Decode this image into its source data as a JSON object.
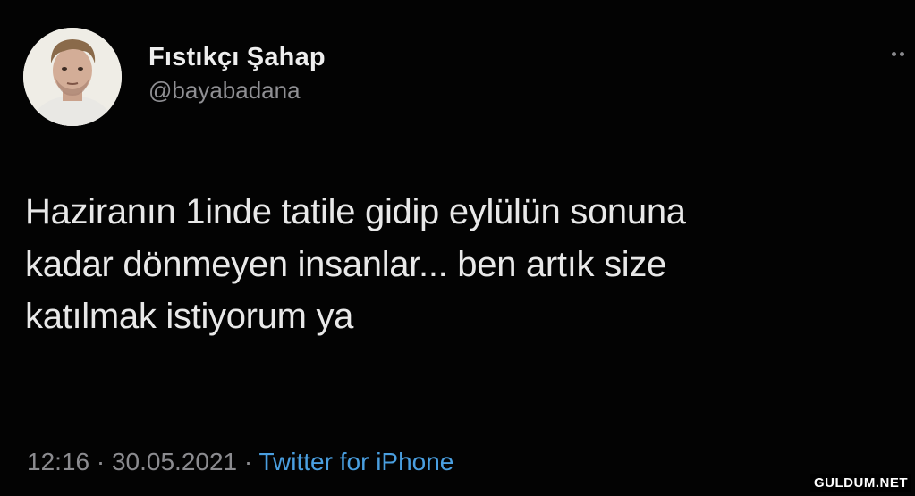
{
  "tweet": {
    "display_name": "Fıstıkçı Şahap",
    "handle": "@bayabadana",
    "text_lines": [
      "Haziranın 1inde tatile gidip eylülün sonuna",
      "kadar dönmeyen insanlar... ben artık size",
      "katılmak istiyorum ya"
    ],
    "time": "12:16",
    "separator": "·",
    "date": "30.05.2021",
    "source": "Twitter for iPhone"
  },
  "icons": {
    "avatar": "profile-photo",
    "more": "more-options-icon"
  },
  "colors": {
    "background": "#030303",
    "link": "#4a9fe0",
    "secondary_text": "#8b8b8f"
  },
  "watermark": "GULDUM.NET"
}
